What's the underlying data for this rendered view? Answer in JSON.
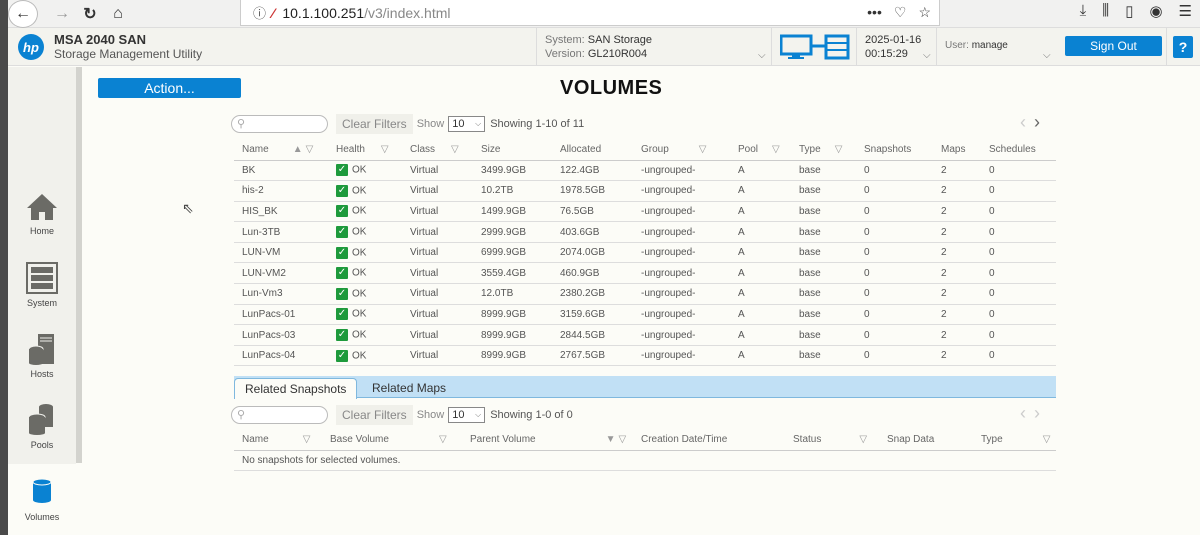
{
  "browser": {
    "url_host": "10.1.100.251",
    "url_path": "/v3/index.html",
    "more_label": "•••"
  },
  "header": {
    "product": "MSA 2040 SAN",
    "subtitle": "Storage Management Utility",
    "logo_text": "hp",
    "system_label": "System:",
    "system_value": "SAN Storage",
    "version_label": "Version:",
    "version_value": "GL210R004",
    "date": "2025-01-16",
    "time": "00:15:29",
    "user_label": "User:",
    "user_value": "manage",
    "sign_out": "Sign Out",
    "help": "?"
  },
  "sidebar": {
    "items": [
      {
        "label": "Home",
        "icon": "home-icon"
      },
      {
        "label": "System",
        "icon": "system-icon"
      },
      {
        "label": "Hosts",
        "icon": "hosts-icon"
      },
      {
        "label": "Pools",
        "icon": "pools-icon"
      },
      {
        "label": "Volumes",
        "icon": "volumes-icon",
        "active": true
      }
    ]
  },
  "main": {
    "action_label": "Action...",
    "title": "VOLUMES",
    "volumes_toolbar": {
      "search_placeholder": "",
      "clear_filters": "Clear Filters",
      "show_label": "Show",
      "show_value": "10",
      "showing": "Showing 1-10 of 11"
    },
    "volumes_columns": [
      "Name",
      "Health",
      "Class",
      "Size",
      "Allocated",
      "Group",
      "Pool",
      "Type",
      "Snapshots",
      "Maps",
      "Schedules"
    ],
    "volumes": [
      {
        "name": "BK",
        "health": "OK",
        "class": "Virtual",
        "size": "3499.9GB",
        "allocated": "122.4GB",
        "group": "-ungrouped-",
        "pool": "A",
        "type": "base",
        "snapshots": "0",
        "maps": "2",
        "schedules": "0"
      },
      {
        "name": "his-2",
        "health": "OK",
        "class": "Virtual",
        "size": "10.2TB",
        "allocated": "1978.5GB",
        "group": "-ungrouped-",
        "pool": "A",
        "type": "base",
        "snapshots": "0",
        "maps": "2",
        "schedules": "0"
      },
      {
        "name": "HIS_BK",
        "health": "OK",
        "class": "Virtual",
        "size": "1499.9GB",
        "allocated": "76.5GB",
        "group": "-ungrouped-",
        "pool": "A",
        "type": "base",
        "snapshots": "0",
        "maps": "2",
        "schedules": "0"
      },
      {
        "name": "Lun-3TB",
        "health": "OK",
        "class": "Virtual",
        "size": "2999.9GB",
        "allocated": "403.6GB",
        "group": "-ungrouped-",
        "pool": "A",
        "type": "base",
        "snapshots": "0",
        "maps": "2",
        "schedules": "0"
      },
      {
        "name": "LUN-VM",
        "health": "OK",
        "class": "Virtual",
        "size": "6999.9GB",
        "allocated": "2074.0GB",
        "group": "-ungrouped-",
        "pool": "A",
        "type": "base",
        "snapshots": "0",
        "maps": "2",
        "schedules": "0"
      },
      {
        "name": "LUN-VM2",
        "health": "OK",
        "class": "Virtual",
        "size": "3559.4GB",
        "allocated": "460.9GB",
        "group": "-ungrouped-",
        "pool": "A",
        "type": "base",
        "snapshots": "0",
        "maps": "2",
        "schedules": "0"
      },
      {
        "name": "Lun-Vm3",
        "health": "OK",
        "class": "Virtual",
        "size": "12.0TB",
        "allocated": "2380.2GB",
        "group": "-ungrouped-",
        "pool": "A",
        "type": "base",
        "snapshots": "0",
        "maps": "2",
        "schedules": "0"
      },
      {
        "name": "LunPacs-01",
        "health": "OK",
        "class": "Virtual",
        "size": "8999.9GB",
        "allocated": "3159.6GB",
        "group": "-ungrouped-",
        "pool": "A",
        "type": "base",
        "snapshots": "0",
        "maps": "2",
        "schedules": "0"
      },
      {
        "name": "LunPacs-03",
        "health": "OK",
        "class": "Virtual",
        "size": "8999.9GB",
        "allocated": "2844.5GB",
        "group": "-ungrouped-",
        "pool": "A",
        "type": "base",
        "snapshots": "0",
        "maps": "2",
        "schedules": "0"
      },
      {
        "name": "LunPacs-04",
        "health": "OK",
        "class": "Virtual",
        "size": "8999.9GB",
        "allocated": "2767.5GB",
        "group": "-ungrouped-",
        "pool": "A",
        "type": "base",
        "snapshots": "0",
        "maps": "2",
        "schedules": "0"
      }
    ],
    "tabs": [
      {
        "label": "Related Snapshots",
        "active": true
      },
      {
        "label": "Related Maps",
        "active": false
      }
    ],
    "snap_toolbar": {
      "clear_filters": "Clear Filters",
      "show_label": "Show",
      "show_value": "10",
      "showing": "Showing 1-0 of 0"
    },
    "snap_columns": [
      "Name",
      "Base Volume",
      "Parent Volume",
      "Creation Date/Time",
      "Status",
      "Snap Data",
      "Type"
    ],
    "snap_empty": "No snapshots for selected volumes."
  },
  "colors": {
    "accent": "#0a82d2",
    "ok_green": "#1e9a3c",
    "tab_bar": "#c1e0f5"
  }
}
